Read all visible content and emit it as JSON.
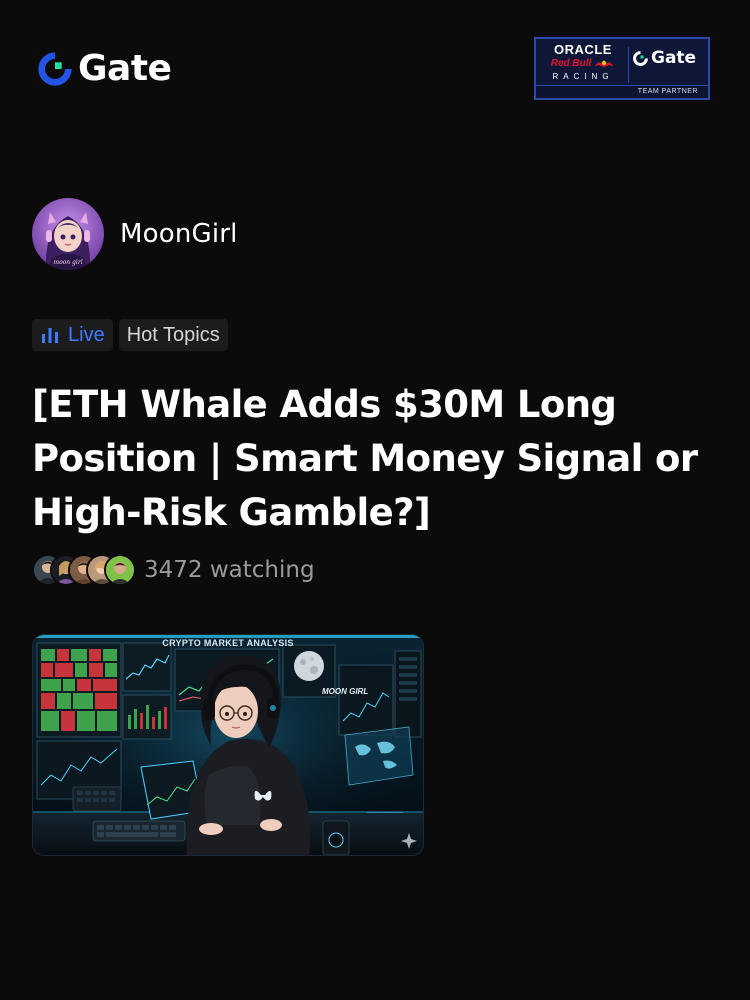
{
  "brand": {
    "name": "Gate",
    "accent": "#2354e6",
    "accent_secondary": "#17e5a5"
  },
  "partner_badge": {
    "line1": "ORACLE",
    "line2": "Red Bull",
    "line3": "RACING",
    "partner_brand": "Gate",
    "footer": "TEAM PARTNER"
  },
  "author": {
    "name": "MoonGirl",
    "avatar_icon": "anime-girl-avatar"
  },
  "tags": {
    "live_label": "Live",
    "live_color": "#3d7cff",
    "topic_label": "Hot Topics"
  },
  "post": {
    "title": "[ETH Whale Adds $30M Long Position | Smart Money Signal or High-Risk Gamble?]",
    "watchers_count": "3472",
    "watching_text": "3472 watching"
  },
  "thumbnail": {
    "overlay_title": "CRYPTO MARKET ANALYSIS",
    "overlay_brand": "MOON GIRL"
  }
}
